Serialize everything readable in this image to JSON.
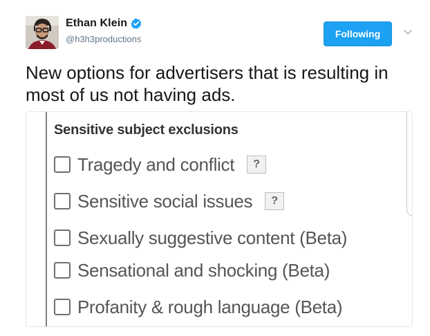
{
  "tweet": {
    "author": {
      "display_name": "Ethan Klein",
      "handle": "@h3h3productions",
      "verified": true,
      "avatar_icon": "profile-photo-avatar"
    },
    "follow_button": {
      "label": "Following",
      "color": "#1da1f2"
    },
    "more_menu_icon": "chevron-down-icon",
    "text": "New options for advertisers that is resulting in most of us not having ads."
  },
  "media": {
    "heading": "Sensitive subject exclusions",
    "options": [
      {
        "label": "Tragedy and conflict",
        "checked": false,
        "help": "?"
      },
      {
        "label": "Sensitive social issues",
        "checked": false,
        "help": "?"
      },
      {
        "label": "Sexually suggestive content (Beta)",
        "checked": false
      },
      {
        "label": "Sensational and shocking (Beta)",
        "checked": false
      },
      {
        "label": "Profanity & rough language (Beta)",
        "checked": false
      }
    ]
  },
  "colors": {
    "accent": "#1da1f2",
    "verified": "#1da1f2",
    "handle": "#657786",
    "text": "#14171a"
  }
}
